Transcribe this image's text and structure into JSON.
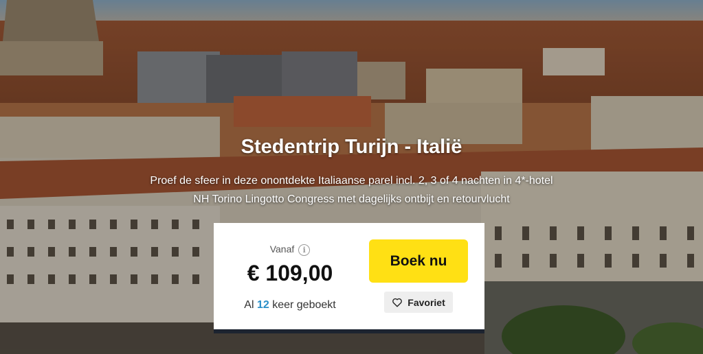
{
  "hero": {
    "title": "Stedentrip Turijn - Italië",
    "subtitle_line1": "Proef de sfeer in deze onontdekte Italiaanse parel incl. 2, 3 of 4 nachten in 4*-hotel",
    "subtitle_line2": "NH Torino Lingotto Congress met dagelijks ontbijt en retourvlucht"
  },
  "offer": {
    "from_label": "Vanaf",
    "info_icon": "info-icon",
    "price": "€ 109,00",
    "booked_prefix": "Al",
    "booked_count": "12",
    "booked_suffix": "keer geboekt",
    "book_label": "Boek nu",
    "favorite_label": "Favoriet",
    "favorite_icon": "heart-outline-icon"
  },
  "colors": {
    "book_button": "#ffe014",
    "booked_count": "#2a8fc8",
    "card_bottom_border": "#1d2430"
  }
}
